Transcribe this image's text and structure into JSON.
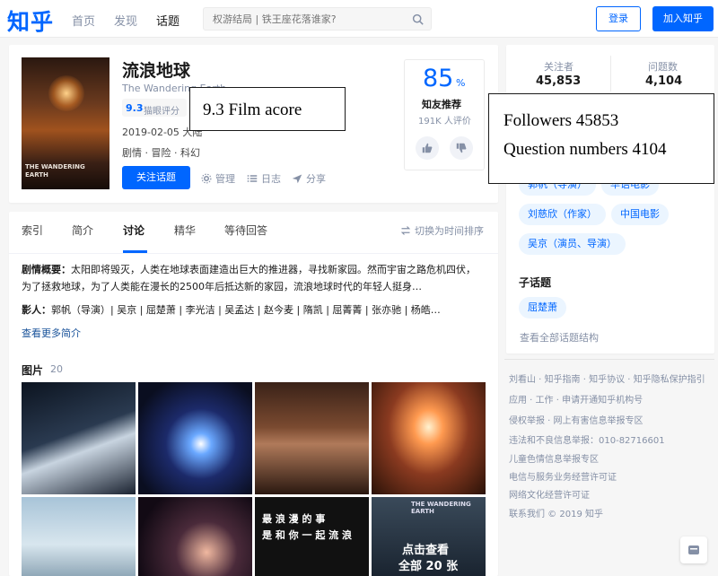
{
  "header": {
    "logo": "知乎",
    "nav": [
      "首页",
      "发现",
      "话题"
    ],
    "search_placeholder": "权游结局 | 铁王座花落谁家?",
    "login_label": "登录",
    "join_label": "加入知乎"
  },
  "topic": {
    "title": "流浪地球",
    "title_en": "The Wandering Earth",
    "rating": "9.3",
    "rating_source": "猫眼评分",
    "release": "2019-02-05 大陆",
    "genres": "剧情 · 冒险 · 科幻",
    "follow_label": "关注话题",
    "actions": [
      "管理",
      "日志",
      "分享"
    ],
    "poster_text": "THE WANDERING EARTH",
    "score": {
      "value": "85",
      "unit": "%",
      "label": "知友推荐",
      "count": "191K 人评价"
    }
  },
  "annotations": {
    "film_score": "9.3 Film acore",
    "followers": "Followers 45853",
    "questions": "Question numbers 4104"
  },
  "tabs": {
    "items": [
      "索引",
      "简介",
      "讨论",
      "精华",
      "等待回答"
    ],
    "active": "讨论",
    "sort_label": "切换为时间排序"
  },
  "summary": {
    "label": "剧情概要：",
    "text": "太阳即将毁灭，人类在地球表面建造出巨大的推进器，寻找新家园。然而宇宙之路危机四伏，为了拯救地球，为了人类能在漫长的2500年后抵达新的家园，流浪地球时代的年轻人挺身…",
    "cast_label": "影人：",
    "cast": "郭帆（导演）| 吴京 | 屈楚萧 | 李光洁 | 吴孟达 | 赵今麦 | 隋凯 | 屈菁菁 | 张亦驰 | 杨皓…",
    "more": "查看更多简介"
  },
  "gallery": {
    "title": "图片",
    "count": "20",
    "caption_1": "最 浪 漫 的 事",
    "caption_2": "是 和 你 一 起 流 浪",
    "view_all_1": "点击查看",
    "view_all_2": "全部 20 张",
    "poster_text": "THE WANDERING EARTH"
  },
  "sidebar": {
    "followers_label": "关注者",
    "followers": "45,853",
    "questions_label": "问题数",
    "questions": "4,104",
    "tags": [
      "郭帆（导演）",
      "华语电影",
      "刘慈欣（作家）",
      "中国电影",
      "吴京（演员、导演）"
    ],
    "sub_title": "子话题",
    "sub_tags": [
      "屈楚萧"
    ],
    "all_structure": "查看全部话题结构"
  },
  "footer": [
    "刘看山 · 知乎指南 · 知乎协议 · 知乎隐私保护指引",
    "应用 · 工作 · 申请开通知乎机构号",
    "侵权举报 · 网上有害信息举报专区",
    "违法和不良信息举报：010-82716601",
    "儿童色情信息举报专区",
    "电信与服务业务经营许可证",
    "网络文化经营许可证",
    "联系我们 © 2019 知乎"
  ],
  "colors": {
    "brand": "#0066ff",
    "muted": "#8590a6",
    "tag_bg": "#ebf5ff"
  }
}
